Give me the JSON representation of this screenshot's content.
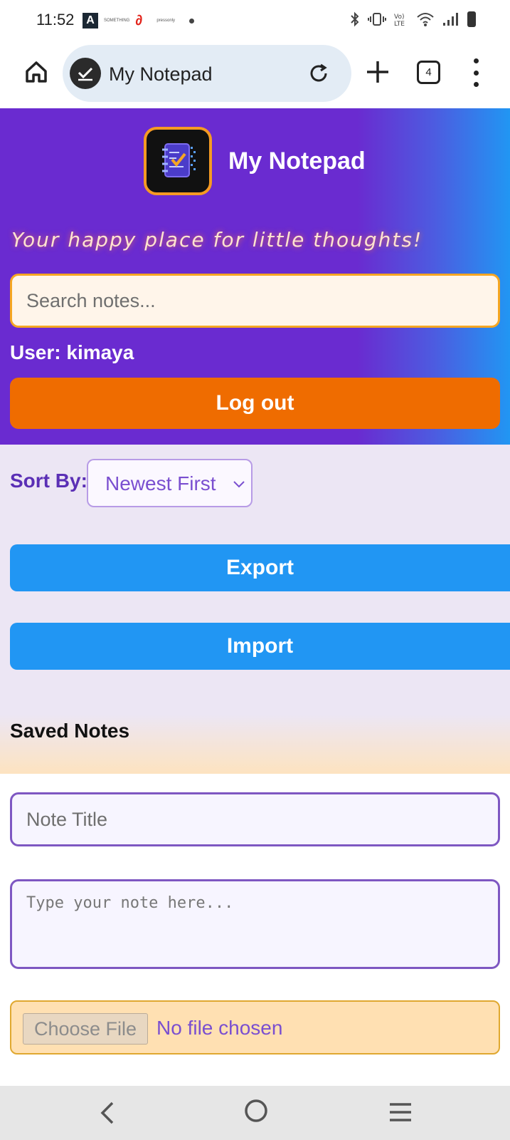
{
  "status_bar": {
    "time": "11:52",
    "carrier_small_1": "SOMETHING",
    "carrier_small_2": "pressonly"
  },
  "browser": {
    "tab_title": "My Notepad",
    "tab_count": "4",
    "icons": [
      "home-icon",
      "checkmark-site-icon",
      "reload-icon",
      "plus-icon",
      "tabs-icon",
      "more-vert-icon"
    ]
  },
  "header": {
    "app_title": "My Notepad",
    "tagline": "Your happy place for little thoughts!",
    "search_placeholder": "Search notes...",
    "user_label": "User: kimaya",
    "logout_label": "Log out",
    "colors": {
      "primary": "#6a2bd0",
      "accent": "#2196f3",
      "logout": "#ef6c00"
    }
  },
  "controls": {
    "sort_label": "Sort By:",
    "sort_value": "Newest First",
    "export_label": "Export",
    "import_label": "Import",
    "saved_notes_heading": "Saved Notes"
  },
  "editor": {
    "title_placeholder": "Note Title",
    "body_placeholder": "Type your note here...",
    "choose_file_label": "Choose File",
    "no_file_text": "No file chosen"
  },
  "navbar": {
    "icons": [
      "back-icon",
      "home-circle-icon",
      "recents-icon"
    ]
  }
}
